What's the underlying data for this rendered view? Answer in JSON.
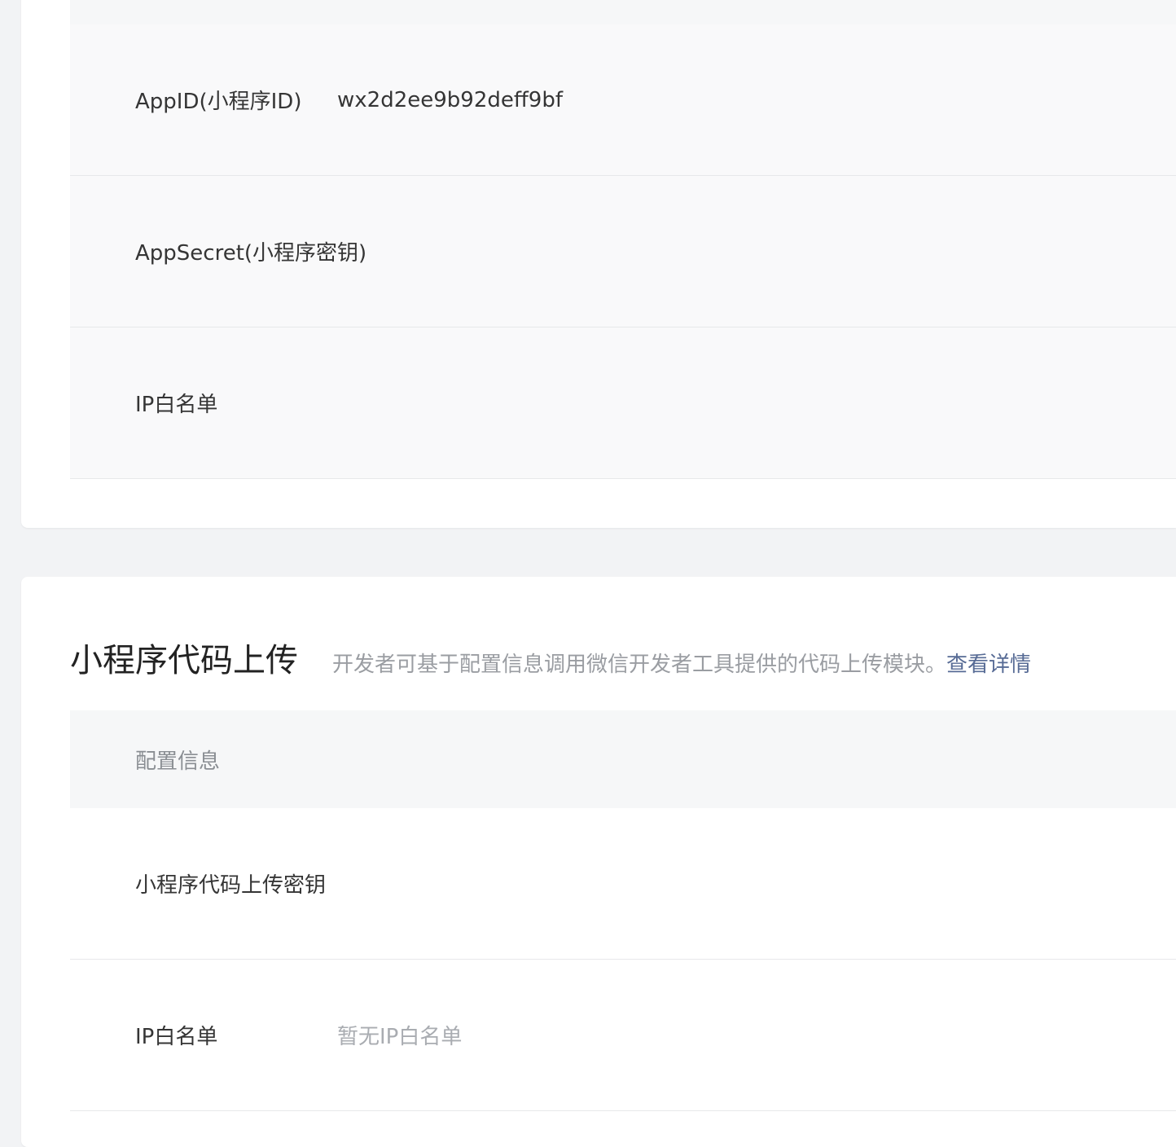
{
  "mini_program_settings": {
    "rows": [
      {
        "label": "AppID(小程序ID)",
        "value": "wx2d2ee9b92deff9bf"
      },
      {
        "label": "AppSecret(小程序密钥)",
        "value": ""
      },
      {
        "label": "IP白名单",
        "value": ""
      }
    ]
  },
  "code_upload": {
    "title": "小程序代码上传",
    "description": "开发者可基于配置信息调用微信开发者工具提供的代码上传模块。",
    "link_label": "查看详情",
    "table_header": "配置信息",
    "rows": [
      {
        "label": "小程序代码上传密钥",
        "value": ""
      },
      {
        "label": "IP白名单",
        "value": "暂无IP白名单"
      }
    ]
  },
  "colors": {
    "link": "#576b95",
    "muted_text": "#a9acb1",
    "page_background": "#f2f3f5"
  }
}
